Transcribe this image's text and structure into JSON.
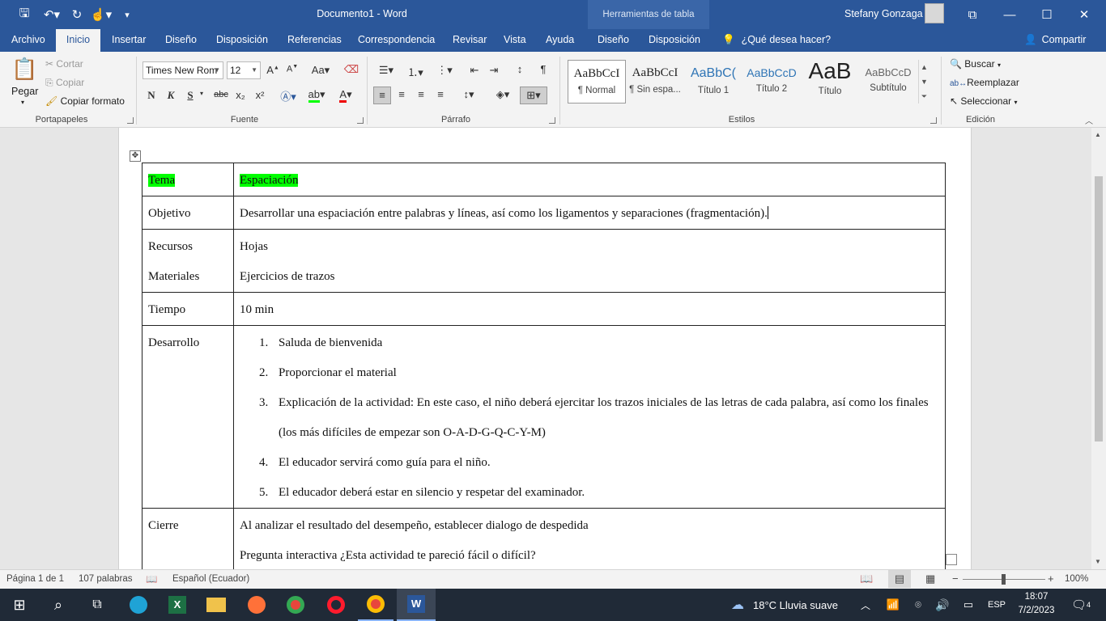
{
  "titlebar": {
    "doc_title": "Documento1  -  Word",
    "table_tools": "Herramientas de tabla",
    "user_name": "Stefany Gonzaga"
  },
  "tabs": {
    "file": "Archivo",
    "inicio": "Inicio",
    "insertar": "Insertar",
    "diseno": "Diseño",
    "disposicion": "Disposición",
    "referencias": "Referencias",
    "correspondencia": "Correspondencia",
    "revisar": "Revisar",
    "vista": "Vista",
    "ayuda": "Ayuda",
    "diseno_tabla": "Diseño",
    "disposicion_tabla": "Disposición",
    "help_search": "¿Qué desea hacer?",
    "share": "Compartir"
  },
  "clipboard": {
    "paste": "Pegar",
    "cut": "Cortar",
    "copy": "Copiar",
    "format_painter": "Copiar formato",
    "group_label": "Portapapeles"
  },
  "font": {
    "font_name": "Times New Rom",
    "font_size": "12",
    "bold": "N",
    "italic": "K",
    "underline": "S",
    "strike": "abc",
    "subscript": "x₂",
    "superscript": "x²",
    "group_label": "Fuente"
  },
  "paragraph": {
    "group_label": "Párrafo"
  },
  "styles": {
    "items": [
      {
        "sample": "AaBbCcI",
        "name": "¶ Normal"
      },
      {
        "sample": "AaBbCcI",
        "name": "¶ Sin espa..."
      },
      {
        "sample": "AaBbC(",
        "name": "Título 1"
      },
      {
        "sample": "AaBbCcD",
        "name": "Título 2"
      },
      {
        "sample": "AaB",
        "name": "Título"
      },
      {
        "sample": "AaBbCcD",
        "name": "Subtítulo"
      }
    ],
    "group_label": "Estilos"
  },
  "editing": {
    "find": "Buscar",
    "replace": "Reemplazar",
    "select": "Seleccionar",
    "group_label": "Edición"
  },
  "document": {
    "rows": [
      {
        "label": "Tema",
        "value": "Espaciación"
      },
      {
        "label": "Objetivo",
        "value": "Desarrollar una espaciación entre palabras y líneas, así como los ligamentos y separaciones (fragmentación)."
      },
      {
        "label": "Recursos",
        "label2": "Materiales",
        "value": "Hojas",
        "value2": "Ejercicios de trazos"
      },
      {
        "label": "Tiempo",
        "value": "10 min"
      },
      {
        "label": "Desarrollo",
        "list": [
          "Saluda de bienvenida",
          "Proporcionar el material",
          "Explicación de la actividad: En este caso, el niño deberá ejercitar los trazos iniciales de las letras de cada palabra, así como los finales (los más difíciles de empezar son O-A-D-G-Q-C-Y-M)",
          "El educador servirá como guía para el niño.",
          "El educador deberá estar en silencio y respetar del examinador."
        ]
      },
      {
        "label": "Cierre",
        "value": "Al analizar el resultado del desempeño, establecer dialogo de despedida",
        "value2": "Pregunta interactiva ¿Esta actividad te pareció fácil o difícil?"
      }
    ]
  },
  "statusbar": {
    "page": "Página 1 de 1",
    "words": "107 palabras",
    "language": "Español (Ecuador)",
    "zoom": "100%"
  },
  "taskbar": {
    "weather": "18°C  Lluvia suave",
    "lang": "ESP",
    "time": "18:07",
    "date": "7/2/2023",
    "notifications": "4"
  },
  "colors": {
    "word_blue": "#2b579a",
    "highlight": "#00ff00"
  }
}
